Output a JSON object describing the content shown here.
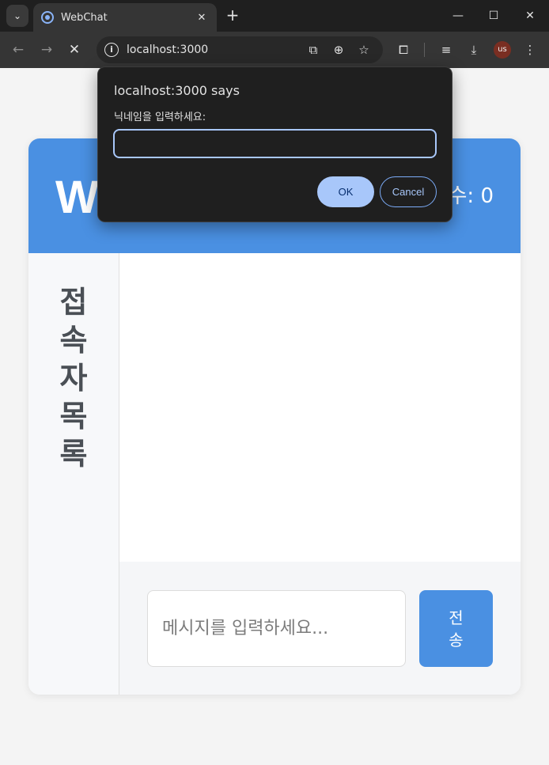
{
  "browser": {
    "tab_title": "WebChat",
    "close_glyph": "✕",
    "new_tab_glyph": "+",
    "url": "localhost:3000",
    "avatar_initials": "us",
    "window": {
      "minimize": "—",
      "maximize": "☐",
      "close": "✕"
    }
  },
  "app": {
    "title": "W",
    "user_count_text": "수: 0",
    "sidebar_title": "접속자목록",
    "message_placeholder": "메시지를 입력하세요...",
    "send_label": "전송"
  },
  "dialog": {
    "title": "localhost:3000 says",
    "message": "닉네임을 입력하세요:",
    "input_value": "",
    "ok_label": "OK",
    "cancel_label": "Cancel"
  },
  "colors": {
    "accent": "#4a90e2",
    "dialog_bg": "#1f1f1f",
    "dialog_button": "#a8c7fa"
  }
}
